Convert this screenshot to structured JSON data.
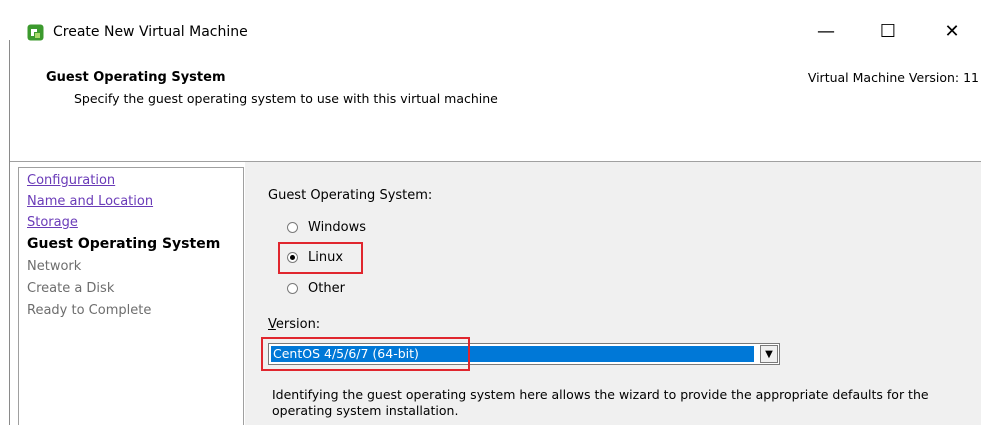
{
  "window": {
    "title": "Create New Virtual Machine",
    "minimize_glyph": "—",
    "maximize_glyph": "☐",
    "close_glyph": "✕"
  },
  "header": {
    "title": "Guest Operating System",
    "subtitle": "Specify the guest operating system to use with this virtual machine",
    "vm_version": "Virtual Machine Version: 11"
  },
  "sidebar": {
    "items": [
      {
        "label": "Configuration",
        "state": "link"
      },
      {
        "label": "Name and Location",
        "state": "link"
      },
      {
        "label": "Storage",
        "state": "link"
      },
      {
        "label": "Guest Operating System",
        "state": "current"
      },
      {
        "label": "Network",
        "state": "disabled"
      },
      {
        "label": "Create a Disk",
        "state": "disabled"
      },
      {
        "label": "Ready to Complete",
        "state": "disabled"
      }
    ]
  },
  "content": {
    "guest_os_label": "Guest Operating System:",
    "options": [
      {
        "label": "Windows",
        "checked": false
      },
      {
        "label": "Linux",
        "checked": true
      },
      {
        "label": "Other",
        "checked": false
      }
    ],
    "version_label_first": "V",
    "version_label_rest": "ersion:",
    "version_value": "CentOS 4/5/6/7 (64-bit)",
    "info_text": "Identifying the guest operating system here allows the wizard to provide the appropriate defaults for the operating system installation."
  },
  "colors": {
    "highlight": "#e0262e",
    "selection": "#0078d7",
    "link": "#6a3bb8"
  }
}
